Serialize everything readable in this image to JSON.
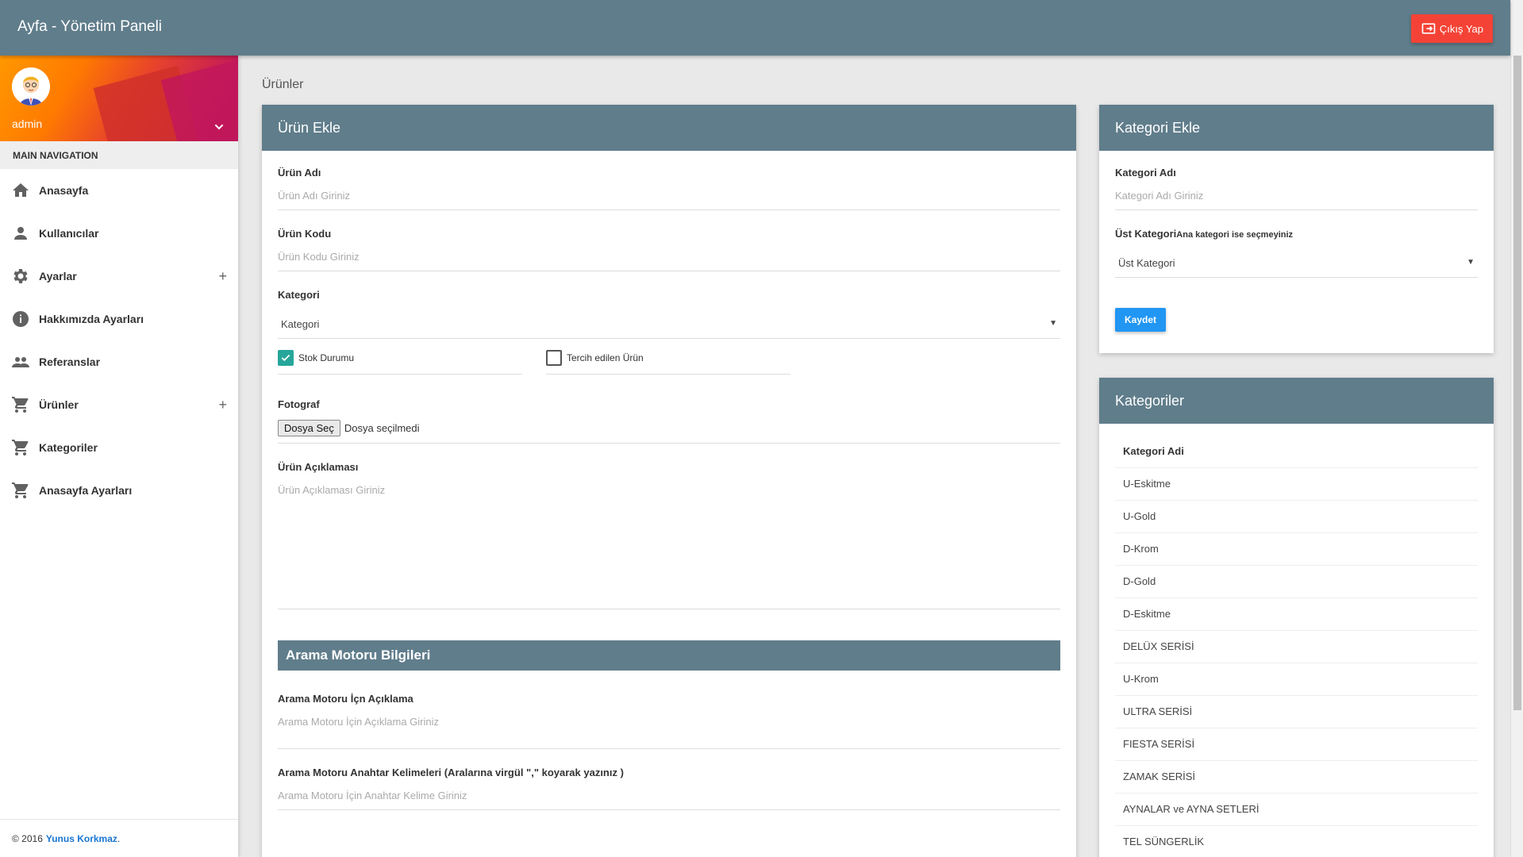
{
  "app": {
    "title": "Ayfa - Yönetim Paneli",
    "logout_label": "Çıkış Yap"
  },
  "user": {
    "name": "admin"
  },
  "nav": {
    "header": "MAIN NAVIGATION",
    "items": [
      {
        "label": "Anasayfa",
        "icon": "home-icon"
      },
      {
        "label": "Kullanıcılar",
        "icon": "person-icon"
      },
      {
        "label": "Ayarlar",
        "icon": "gear-icon",
        "expandable": true
      },
      {
        "label": "Hakkımızda Ayarları",
        "icon": "info-icon"
      },
      {
        "label": "Referanslar",
        "icon": "people-icon"
      },
      {
        "label": "Ürünler",
        "icon": "cart-icon",
        "expandable": true
      },
      {
        "label": "Kategoriler",
        "icon": "cart-icon"
      },
      {
        "label": "Anasayfa Ayarları",
        "icon": "cart-icon"
      }
    ]
  },
  "footer": {
    "copyright": "© 2016",
    "author": "Yunus Korkmaz",
    "suffix": "."
  },
  "page": {
    "title": "Ürünler"
  },
  "product_form": {
    "title": "Ürün Ekle",
    "name_label": "Ürün Adı",
    "name_placeholder": "Ürün Adı Giriniz",
    "code_label": "Ürün Kodu",
    "code_placeholder": "Ürün Kodu Giriniz",
    "category_label": "Kategori",
    "category_value": "Kategori",
    "stock_label": "Stok Durumu",
    "stock_checked": true,
    "preferred_label": "Tercih edilen Ürün",
    "preferred_checked": false,
    "photo_label": "Fotograf",
    "file_button": "Dosya Seç",
    "file_status": "Dosya seçilmedi",
    "desc_label": "Ürün Açıklaması",
    "desc_placeholder": "Ürün Açıklaması Giriniz",
    "seo_header": "Arama Motoru Bilgileri",
    "seo_desc_label": "Arama Motoru İçn Açıklama",
    "seo_desc_placeholder": "Arama Motoru İçin Açıklama Giriniz",
    "seo_keywords_label": "Arama Motoru Anahtar Kelimeleri (Aralarına virgül \",\" koyarak yazınız )",
    "seo_keywords_placeholder": "Arama Motoru İçin Anahtar Kelime Giriniz"
  },
  "category_form": {
    "title": "Kategori Ekle",
    "name_label": "Kategori Adı",
    "name_placeholder": "Kategori Adı Giriniz",
    "parent_label": "Üst Kategori",
    "parent_hint": "Ana kategori ise seçmeyiniz",
    "parent_value": "Üst Kategori",
    "save_label": "Kaydet"
  },
  "categories": {
    "title": "Kategoriler",
    "column": "Kategori Adi",
    "rows": [
      "U-Eskitme",
      "U-Gold",
      "D-Krom",
      "D-Gold",
      "D-Eskitme",
      "DELÜX SERİSİ",
      "U-Krom",
      "ULTRA SERİSİ",
      "FIESTA SERİSİ",
      "ZAMAK SERİSİ",
      "AYNALAR ve AYNA SETLERİ",
      "TEL SÜNGERLİK"
    ]
  },
  "colors": {
    "primary": "#607d8b",
    "danger": "#f44336",
    "accent": "#2196f3",
    "check": "#26a69a"
  }
}
